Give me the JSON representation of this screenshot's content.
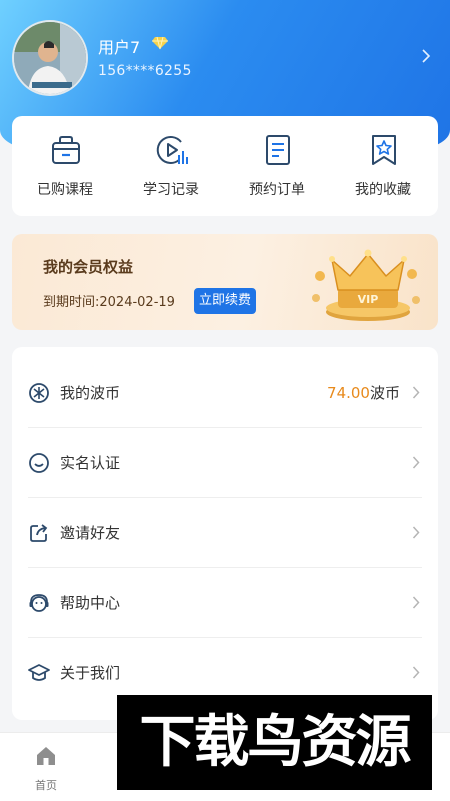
{
  "user": {
    "name": "用户7",
    "phone": "156****6255"
  },
  "quick_actions": [
    {
      "label": "已购课程",
      "icon": "basket-icon"
    },
    {
      "label": "学习记录",
      "icon": "play-stats-icon"
    },
    {
      "label": "预约订单",
      "icon": "document-icon"
    },
    {
      "label": "我的收藏",
      "icon": "bookmark-star-icon"
    }
  ],
  "vip": {
    "title": "我的会员权益",
    "expire_text": "到期时间:2024-02-19",
    "renew_label": "立即续费",
    "badge_text": "VIP"
  },
  "menu": {
    "coins": {
      "label": "我的波币",
      "value": "74.00",
      "unit": "波币"
    },
    "items": [
      {
        "label": "实名认证",
        "icon": "smile-face-icon"
      },
      {
        "label": "邀请好友",
        "icon": "share-icon"
      },
      {
        "label": "帮助中心",
        "icon": "support-icon"
      },
      {
        "label": "关于我们",
        "icon": "graduation-cap-icon"
      }
    ]
  },
  "tabbar": {
    "home_label": "首页"
  },
  "watermark": "下载鸟资源",
  "colors": {
    "accent": "#1f74e6",
    "coin": "#e88a1c",
    "icon": "#2d4a6b"
  }
}
